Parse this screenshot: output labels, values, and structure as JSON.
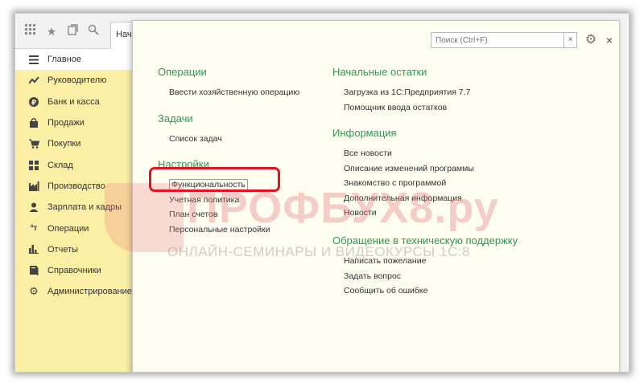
{
  "toolbar": {
    "apps_icon": "grid-icon",
    "favorites_icon": "star-icon",
    "history_icon": "history-icon",
    "search_icon": "search-icon",
    "tab_label": "Нач"
  },
  "sidebar": {
    "items": [
      {
        "label": "Главное",
        "icon": "menu-icon",
        "active": true
      },
      {
        "label": "Руководителю",
        "icon": "trend-icon"
      },
      {
        "label": "Банк и касса",
        "icon": "ruble-icon"
      },
      {
        "label": "Продажи",
        "icon": "bag-icon"
      },
      {
        "label": "Покупки",
        "icon": "cart-icon"
      },
      {
        "label": "Склад",
        "icon": "warehouse-icon"
      },
      {
        "label": "Производство",
        "icon": "factory-icon"
      },
      {
        "label": "Зарплата и кадры",
        "icon": "person-icon"
      },
      {
        "label": "Операции",
        "icon": "operations-icon"
      },
      {
        "label": "Отчеты",
        "icon": "bar-chart-icon"
      },
      {
        "label": "Справочники",
        "icon": "book-icon"
      },
      {
        "label": "Администрирование",
        "icon": "gear-icon"
      }
    ]
  },
  "panel": {
    "search_placeholder": "Поиск (Ctrl+F)",
    "search_clear": "×",
    "close": "×",
    "left": {
      "operations": {
        "title": "Операции",
        "links": [
          "Ввести хозяйственную операцию"
        ]
      },
      "tasks": {
        "title": "Задачи",
        "links": [
          "Список задач"
        ]
      },
      "settings": {
        "title": "Настройки",
        "links": [
          "Функциональность",
          "Учетная политика",
          "План счетов",
          "Персональные настройки"
        ]
      }
    },
    "right": {
      "balances": {
        "title": "Начальные остатки",
        "links": [
          "Загрузка из 1С:Предприятия 7.7",
          "Помощник ввода остатков"
        ]
      },
      "info": {
        "title": "Информация",
        "links": [
          "Все новости",
          "Описание изменений программы",
          "Знакомство с программой",
          "Дополнительная информация",
          "Новости"
        ]
      },
      "support": {
        "title": "Обращение в техническую поддержку",
        "links": [
          "Написать пожелание",
          "Задать вопрос",
          "Сообщить об ошибке"
        ]
      }
    }
  },
  "watermark": {
    "big": "ПРОФБУХ8.ру",
    "small": "ОНЛАЙН-СЕМИНАРЫ И ВИДЕОКУРСЫ 1С:8"
  },
  "colors": {
    "sidebar_bg": "#fbeea5",
    "section_title": "#2e9a52",
    "highlight": "#e0141e"
  }
}
